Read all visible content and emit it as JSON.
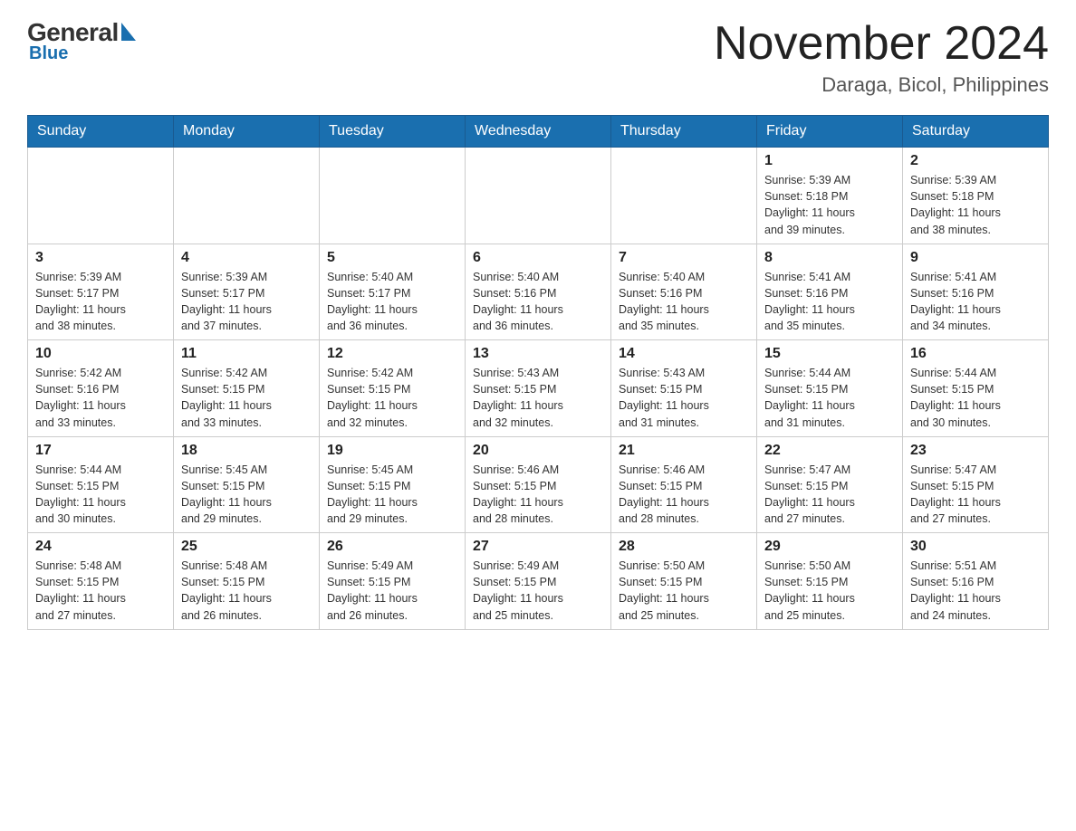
{
  "header": {
    "logo_general": "General",
    "logo_blue": "Blue",
    "month_year": "November 2024",
    "location": "Daraga, Bicol, Philippines"
  },
  "weekdays": [
    "Sunday",
    "Monday",
    "Tuesday",
    "Wednesday",
    "Thursday",
    "Friday",
    "Saturday"
  ],
  "weeks": [
    [
      {
        "day": "",
        "info": ""
      },
      {
        "day": "",
        "info": ""
      },
      {
        "day": "",
        "info": ""
      },
      {
        "day": "",
        "info": ""
      },
      {
        "day": "",
        "info": ""
      },
      {
        "day": "1",
        "info": "Sunrise: 5:39 AM\nSunset: 5:18 PM\nDaylight: 11 hours\nand 39 minutes."
      },
      {
        "day": "2",
        "info": "Sunrise: 5:39 AM\nSunset: 5:18 PM\nDaylight: 11 hours\nand 38 minutes."
      }
    ],
    [
      {
        "day": "3",
        "info": "Sunrise: 5:39 AM\nSunset: 5:17 PM\nDaylight: 11 hours\nand 38 minutes."
      },
      {
        "day": "4",
        "info": "Sunrise: 5:39 AM\nSunset: 5:17 PM\nDaylight: 11 hours\nand 37 minutes."
      },
      {
        "day": "5",
        "info": "Sunrise: 5:40 AM\nSunset: 5:17 PM\nDaylight: 11 hours\nand 36 minutes."
      },
      {
        "day": "6",
        "info": "Sunrise: 5:40 AM\nSunset: 5:16 PM\nDaylight: 11 hours\nand 36 minutes."
      },
      {
        "day": "7",
        "info": "Sunrise: 5:40 AM\nSunset: 5:16 PM\nDaylight: 11 hours\nand 35 minutes."
      },
      {
        "day": "8",
        "info": "Sunrise: 5:41 AM\nSunset: 5:16 PM\nDaylight: 11 hours\nand 35 minutes."
      },
      {
        "day": "9",
        "info": "Sunrise: 5:41 AM\nSunset: 5:16 PM\nDaylight: 11 hours\nand 34 minutes."
      }
    ],
    [
      {
        "day": "10",
        "info": "Sunrise: 5:42 AM\nSunset: 5:16 PM\nDaylight: 11 hours\nand 33 minutes."
      },
      {
        "day": "11",
        "info": "Sunrise: 5:42 AM\nSunset: 5:15 PM\nDaylight: 11 hours\nand 33 minutes."
      },
      {
        "day": "12",
        "info": "Sunrise: 5:42 AM\nSunset: 5:15 PM\nDaylight: 11 hours\nand 32 minutes."
      },
      {
        "day": "13",
        "info": "Sunrise: 5:43 AM\nSunset: 5:15 PM\nDaylight: 11 hours\nand 32 minutes."
      },
      {
        "day": "14",
        "info": "Sunrise: 5:43 AM\nSunset: 5:15 PM\nDaylight: 11 hours\nand 31 minutes."
      },
      {
        "day": "15",
        "info": "Sunrise: 5:44 AM\nSunset: 5:15 PM\nDaylight: 11 hours\nand 31 minutes."
      },
      {
        "day": "16",
        "info": "Sunrise: 5:44 AM\nSunset: 5:15 PM\nDaylight: 11 hours\nand 30 minutes."
      }
    ],
    [
      {
        "day": "17",
        "info": "Sunrise: 5:44 AM\nSunset: 5:15 PM\nDaylight: 11 hours\nand 30 minutes."
      },
      {
        "day": "18",
        "info": "Sunrise: 5:45 AM\nSunset: 5:15 PM\nDaylight: 11 hours\nand 29 minutes."
      },
      {
        "day": "19",
        "info": "Sunrise: 5:45 AM\nSunset: 5:15 PM\nDaylight: 11 hours\nand 29 minutes."
      },
      {
        "day": "20",
        "info": "Sunrise: 5:46 AM\nSunset: 5:15 PM\nDaylight: 11 hours\nand 28 minutes."
      },
      {
        "day": "21",
        "info": "Sunrise: 5:46 AM\nSunset: 5:15 PM\nDaylight: 11 hours\nand 28 minutes."
      },
      {
        "day": "22",
        "info": "Sunrise: 5:47 AM\nSunset: 5:15 PM\nDaylight: 11 hours\nand 27 minutes."
      },
      {
        "day": "23",
        "info": "Sunrise: 5:47 AM\nSunset: 5:15 PM\nDaylight: 11 hours\nand 27 minutes."
      }
    ],
    [
      {
        "day": "24",
        "info": "Sunrise: 5:48 AM\nSunset: 5:15 PM\nDaylight: 11 hours\nand 27 minutes."
      },
      {
        "day": "25",
        "info": "Sunrise: 5:48 AM\nSunset: 5:15 PM\nDaylight: 11 hours\nand 26 minutes."
      },
      {
        "day": "26",
        "info": "Sunrise: 5:49 AM\nSunset: 5:15 PM\nDaylight: 11 hours\nand 26 minutes."
      },
      {
        "day": "27",
        "info": "Sunrise: 5:49 AM\nSunset: 5:15 PM\nDaylight: 11 hours\nand 25 minutes."
      },
      {
        "day": "28",
        "info": "Sunrise: 5:50 AM\nSunset: 5:15 PM\nDaylight: 11 hours\nand 25 minutes."
      },
      {
        "day": "29",
        "info": "Sunrise: 5:50 AM\nSunset: 5:15 PM\nDaylight: 11 hours\nand 25 minutes."
      },
      {
        "day": "30",
        "info": "Sunrise: 5:51 AM\nSunset: 5:16 PM\nDaylight: 11 hours\nand 24 minutes."
      }
    ]
  ]
}
